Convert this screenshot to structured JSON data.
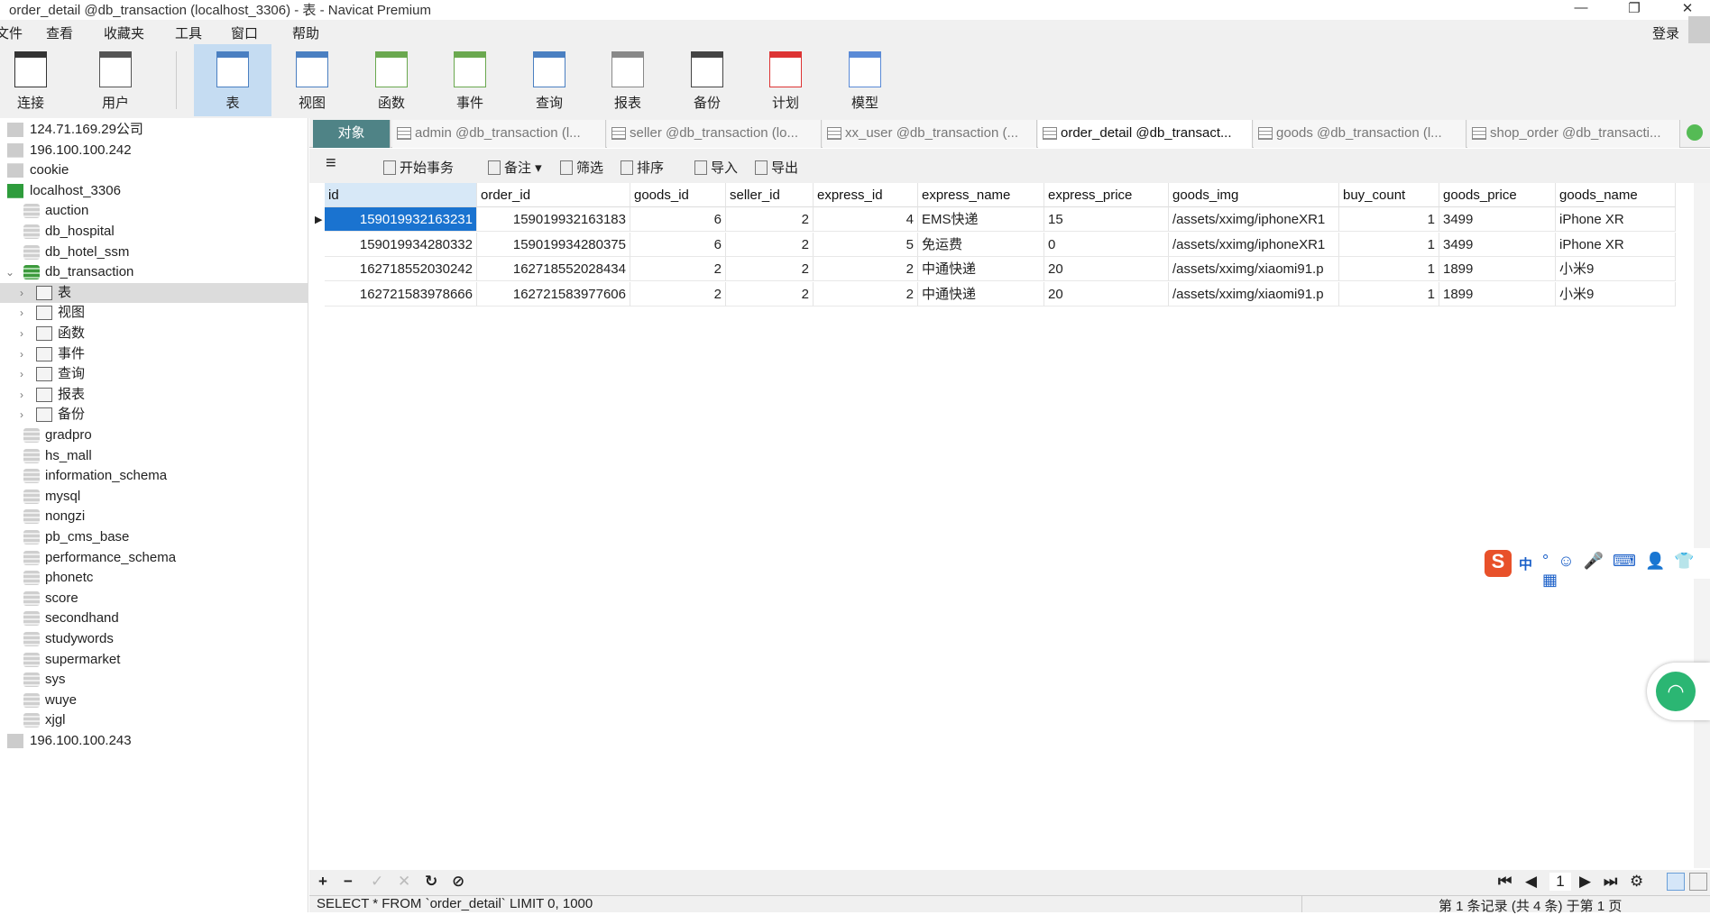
{
  "window": {
    "title": "order_detail @db_transaction (localhost_3306) - 表 - Navicat Premium",
    "minimize": "—",
    "restore": "❐",
    "close": "✕"
  },
  "menu": [
    "文件",
    "查看",
    "收藏夹",
    "工具",
    "窗口",
    "帮助"
  ],
  "login": "登录",
  "toolbar": [
    {
      "label": "连接",
      "icon": "connection-icon"
    },
    {
      "label": "用户",
      "icon": "user-icon"
    },
    {
      "label": "表",
      "icon": "table-icon",
      "active": true
    },
    {
      "label": "视图",
      "icon": "view-icon"
    },
    {
      "label": "函数",
      "icon": "function-icon"
    },
    {
      "label": "事件",
      "icon": "event-icon"
    },
    {
      "label": "查询",
      "icon": "query-icon"
    },
    {
      "label": "报表",
      "icon": "report-icon"
    },
    {
      "label": "备份",
      "icon": "backup-icon"
    },
    {
      "label": "计划",
      "icon": "schedule-icon"
    },
    {
      "label": "模型",
      "icon": "model-icon"
    }
  ],
  "sidebar": [
    {
      "label": "124.71.169.29公司",
      "type": "server",
      "level": 0
    },
    {
      "label": "196.100.100.242",
      "type": "server",
      "level": 0
    },
    {
      "label": "cookie",
      "type": "server",
      "level": 0
    },
    {
      "label": "localhost_3306",
      "type": "server-open",
      "level": 0
    },
    {
      "label": "auction",
      "type": "db",
      "level": 1
    },
    {
      "label": "db_hospital",
      "type": "db",
      "level": 1
    },
    {
      "label": "db_hotel_ssm",
      "type": "db",
      "level": 1
    },
    {
      "label": "db_transaction",
      "type": "db-open",
      "level": 1
    },
    {
      "label": "表",
      "type": "node",
      "level": 2,
      "selected": true
    },
    {
      "label": "视图",
      "type": "node",
      "level": 2
    },
    {
      "label": "函数",
      "type": "node",
      "level": 2
    },
    {
      "label": "事件",
      "type": "node",
      "level": 2
    },
    {
      "label": "查询",
      "type": "node",
      "level": 2
    },
    {
      "label": "报表",
      "type": "node",
      "level": 2
    },
    {
      "label": "备份",
      "type": "node",
      "level": 2
    },
    {
      "label": "gradpro",
      "type": "db",
      "level": 1
    },
    {
      "label": "hs_mall",
      "type": "db",
      "level": 1
    },
    {
      "label": "information_schema",
      "type": "db",
      "level": 1
    },
    {
      "label": "mysql",
      "type": "db",
      "level": 1
    },
    {
      "label": "nongzi",
      "type": "db",
      "level": 1
    },
    {
      "label": "pb_cms_base",
      "type": "db",
      "level": 1
    },
    {
      "label": "performance_schema",
      "type": "db",
      "level": 1
    },
    {
      "label": "phonetc",
      "type": "db",
      "level": 1
    },
    {
      "label": "score",
      "type": "db",
      "level": 1
    },
    {
      "label": "secondhand",
      "type": "db",
      "level": 1
    },
    {
      "label": "studywords",
      "type": "db",
      "level": 1
    },
    {
      "label": "supermarket",
      "type": "db",
      "level": 1
    },
    {
      "label": "sys",
      "type": "db",
      "level": 1
    },
    {
      "label": "wuye",
      "type": "db",
      "level": 1
    },
    {
      "label": "xjgl",
      "type": "db",
      "level": 1
    },
    {
      "label": "196.100.100.243",
      "type": "server",
      "level": 0
    }
  ],
  "tabs": [
    {
      "label": "对象"
    },
    {
      "label": "admin @db_transaction (l..."
    },
    {
      "label": "seller @db_transaction (lo..."
    },
    {
      "label": "xx_user @db_transaction (..."
    },
    {
      "label": "order_detail @db_transact...",
      "current": true
    },
    {
      "label": "goods @db_transaction (l..."
    },
    {
      "label": "shop_order @db_transacti..."
    }
  ],
  "subtoolbar": {
    "begin_tx": "开始事务",
    "note": "备注",
    "filter": "筛选",
    "sort": "排序",
    "import": "导入",
    "export": "导出"
  },
  "table": {
    "columns": [
      "id",
      "order_id",
      "goods_id",
      "seller_id",
      "express_id",
      "express_name",
      "express_price",
      "goods_img",
      "buy_count",
      "goods_price",
      "goods_name"
    ],
    "rows": [
      [
        "159019932163231",
        "159019932163183",
        "6",
        "2",
        "4",
        "EMS快递",
        "15",
        "/assets/xximg/iphoneXR1",
        "1",
        "3499",
        "iPhone XR"
      ],
      [
        "159019934280332",
        "159019934280375",
        "6",
        "2",
        "5",
        "免运费",
        "0",
        "/assets/xximg/iphoneXR1",
        "1",
        "3499",
        "iPhone XR"
      ],
      [
        "162718552030242",
        "162718552028434",
        "2",
        "2",
        "2",
        "中通快递",
        "20",
        "/assets/xximg/xiaomi91.p",
        "1",
        "1899",
        "小米9"
      ],
      [
        "162721583978666",
        "162721583977606",
        "2",
        "2",
        "2",
        "中通快递",
        "20",
        "/assets/xximg/xiaomi91.p",
        "1",
        "1899",
        "小米9"
      ]
    ]
  },
  "bottombar": {
    "add": "+",
    "remove": "−",
    "apply": "✓",
    "discard": "✕",
    "refresh": "↻",
    "stop": "⊘",
    "page": "1"
  },
  "status": {
    "sql": "SELECT * FROM `order_detail` LIMIT 0, 1000",
    "records": "第 1 条记录 (共 4 条) 于第 1 页"
  },
  "ime": {
    "lang": "中"
  }
}
